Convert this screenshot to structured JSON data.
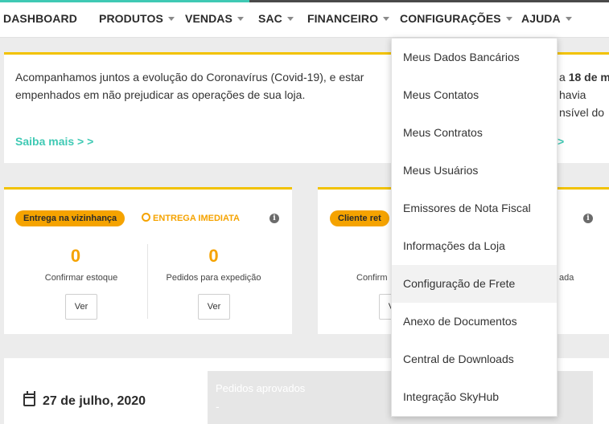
{
  "nav": {
    "items": [
      {
        "label": "DASHBOARD",
        "caret": false
      },
      {
        "label": "PRODUTOS",
        "caret": true
      },
      {
        "label": "VENDAS",
        "caret": true
      },
      {
        "label": "SAC",
        "caret": true
      },
      {
        "label": "FINANCEIRO",
        "caret": true
      },
      {
        "label": "CONFIGURAÇÕES",
        "caret": true
      },
      {
        "label": "AJUDA",
        "caret": true
      }
    ]
  },
  "notice": {
    "line1": "Acompanhamos juntos a evolução do Coronavírus (Covid-19), e estar",
    "line2": "empenhados em não prejudicar as operações de sua loja.",
    "right1_prefix": "a",
    "right1_bold": "18 de m",
    "right2": "havia",
    "right3": "nsível do",
    "more_label": "Saiba mais",
    "more_arrows": "> >",
    "more_arrow_right": ">"
  },
  "card1": {
    "badge": "Entrega na vizinhança",
    "immediate_label": "ENTREGA IMEDIATA",
    "info_icon": "i",
    "stats": [
      {
        "value": "0",
        "label": "Confirmar estoque",
        "button": "Ver"
      },
      {
        "value": "0",
        "label": "Pedidos para expedição",
        "button": "Ver"
      }
    ]
  },
  "card2": {
    "badge": "Cliente ret",
    "info_icon": "i",
    "label_left": "Confirm",
    "label_right": "ada",
    "button": "Ver"
  },
  "bottom": {
    "date": "27 de julho, 2020",
    "approved_title": "Pedidos aprovados",
    "approved_value": "-"
  },
  "dropdown": {
    "items": [
      "Meus Dados Bancários",
      "Meus Contatos",
      "Meus Contratos",
      "Meus Usuários",
      "Emissores de Nota Fiscal",
      "Informações da Loja",
      "Configuração de Frete",
      "Anexo de Documentos",
      "Central de Downloads",
      "Integração SkyHub"
    ],
    "hovered": "Configuração de Frete"
  },
  "colors": {
    "accent_teal": "#3fc9b4",
    "accent_yellow": "#f2c200",
    "badge_orange": "#f5a300"
  }
}
